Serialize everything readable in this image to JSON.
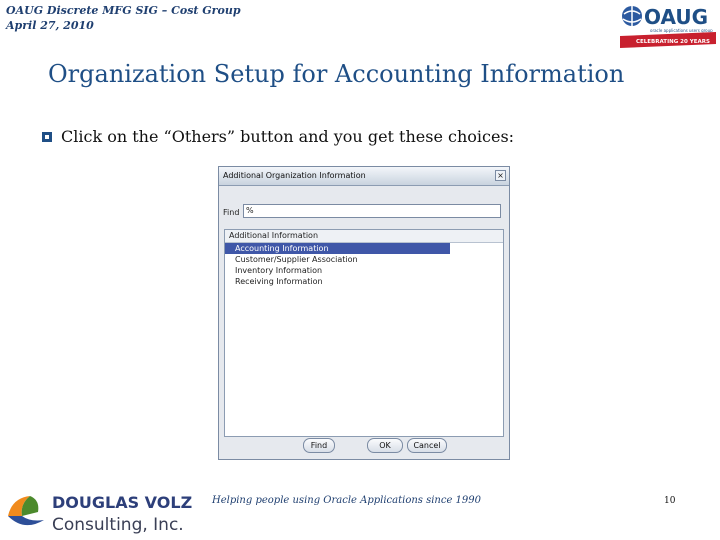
{
  "header": {
    "line1": "OAUG Discrete MFG SIG – Cost Group",
    "line2": "April 27, 2010"
  },
  "oaug_logo": {
    "text": "OAUG",
    "tagline": "oracle applications users group",
    "ribbon": "CELEBRATING 20 YEARS"
  },
  "slide": {
    "title": "Organization Setup for Accounting Information",
    "bullet": "Click on the “Others” button and you get these choices:"
  },
  "dialog": {
    "title": "Additional Organization Information",
    "close_glyph": "×",
    "find_label": "Find",
    "find_value": "%",
    "column_header": "Additional Information",
    "items": [
      "Accounting Information",
      "Customer/Supplier Association",
      "Inventory Information",
      "Receiving Information"
    ],
    "selected_index": 0,
    "buttons": {
      "find": "Find",
      "ok": "OK",
      "cancel": "Cancel"
    }
  },
  "footer": {
    "tagline": "Helping people using Oracle Applications since 1990",
    "page_number": "10"
  },
  "company_logo": {
    "line1": "DOUGLAS VOLZ",
    "line2": "Consulting, Inc."
  },
  "colors": {
    "title_blue": "#1f4f86",
    "selection": "#3f57a8"
  }
}
